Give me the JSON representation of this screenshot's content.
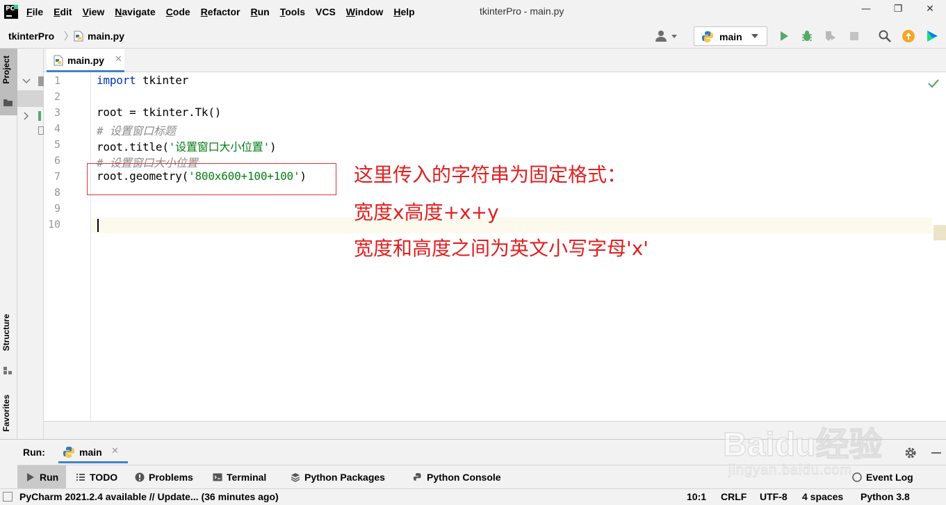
{
  "window": {
    "title": "tkinterPro - main.py",
    "minimize": "—",
    "maximize": "❐",
    "close": "✕"
  },
  "menu": [
    {
      "mnemonic": "F",
      "rest": "ile"
    },
    {
      "mnemonic": "E",
      "rest": "dit"
    },
    {
      "mnemonic": "V",
      "rest": "iew"
    },
    {
      "mnemonic": "N",
      "rest": "avigate"
    },
    {
      "mnemonic": "C",
      "rest": "ode"
    },
    {
      "mnemonic": "R",
      "rest": "efactor"
    },
    {
      "mnemonic": "R",
      "rest": "un"
    },
    {
      "mnemonic": "T",
      "rest": "ools"
    },
    {
      "mnemonic": "",
      "rest": "VCS"
    },
    {
      "mnemonic": "W",
      "rest": "indow"
    },
    {
      "mnemonic": "H",
      "rest": "elp"
    }
  ],
  "navbar": {
    "project": "tkinterPro",
    "separator": "〉",
    "file": "main.py",
    "run_config": "main"
  },
  "left_tool_windows": {
    "project": "Project",
    "structure": "Structure",
    "favorites": "Favorites"
  },
  "editor": {
    "tab_label": "main.py",
    "tab_close": "✕",
    "line_numbers": [
      "1",
      "2",
      "3",
      "4",
      "5",
      "6",
      "7",
      "8",
      "9",
      "10"
    ],
    "lines": {
      "l1_keyword": "import",
      "l1_rest": " tkinter",
      "l3": "root = tkinter.Tk()",
      "l4": "# 设置窗口标题",
      "l5_pre": "root.title(",
      "l5_str": "'设置窗口大小位置'",
      "l5_post": ")",
      "l6": "# 设置窗口大小位置",
      "l7_pre": "root.geometry(",
      "l7_str": "'800x600+100+100'",
      "l7_post": ")"
    },
    "annotation": {
      "line1": "这里传入的字符串为固定格式：",
      "line2": "宽度x高度+x+y",
      "line3": "宽度和高度之间为英文小写字母'x'"
    }
  },
  "run_panel": {
    "title": "Run:",
    "tab_label": "main",
    "tab_close": "✕"
  },
  "tool_windows": [
    "Run",
    "TODO",
    "Problems",
    "Terminal",
    "Python Packages",
    "Python Console",
    "Event Log"
  ],
  "status_bar": {
    "message": "PyCharm 2021.2.4 available // Update... (36 minutes ago)",
    "position": "10:1",
    "line_sep": "CRLF",
    "encoding": "UTF-8",
    "indent": "4 spaces",
    "interpreter": "Python 3.8"
  },
  "watermark": {
    "logo": "Baidu经验",
    "url": "jingyan.baidu.com"
  },
  "colors": {
    "keyword": "#0033b3",
    "string": "#067d17",
    "comment": "#8c8c8c",
    "annotation": "#e02020",
    "selected_tab_underline": "#4083c9"
  }
}
